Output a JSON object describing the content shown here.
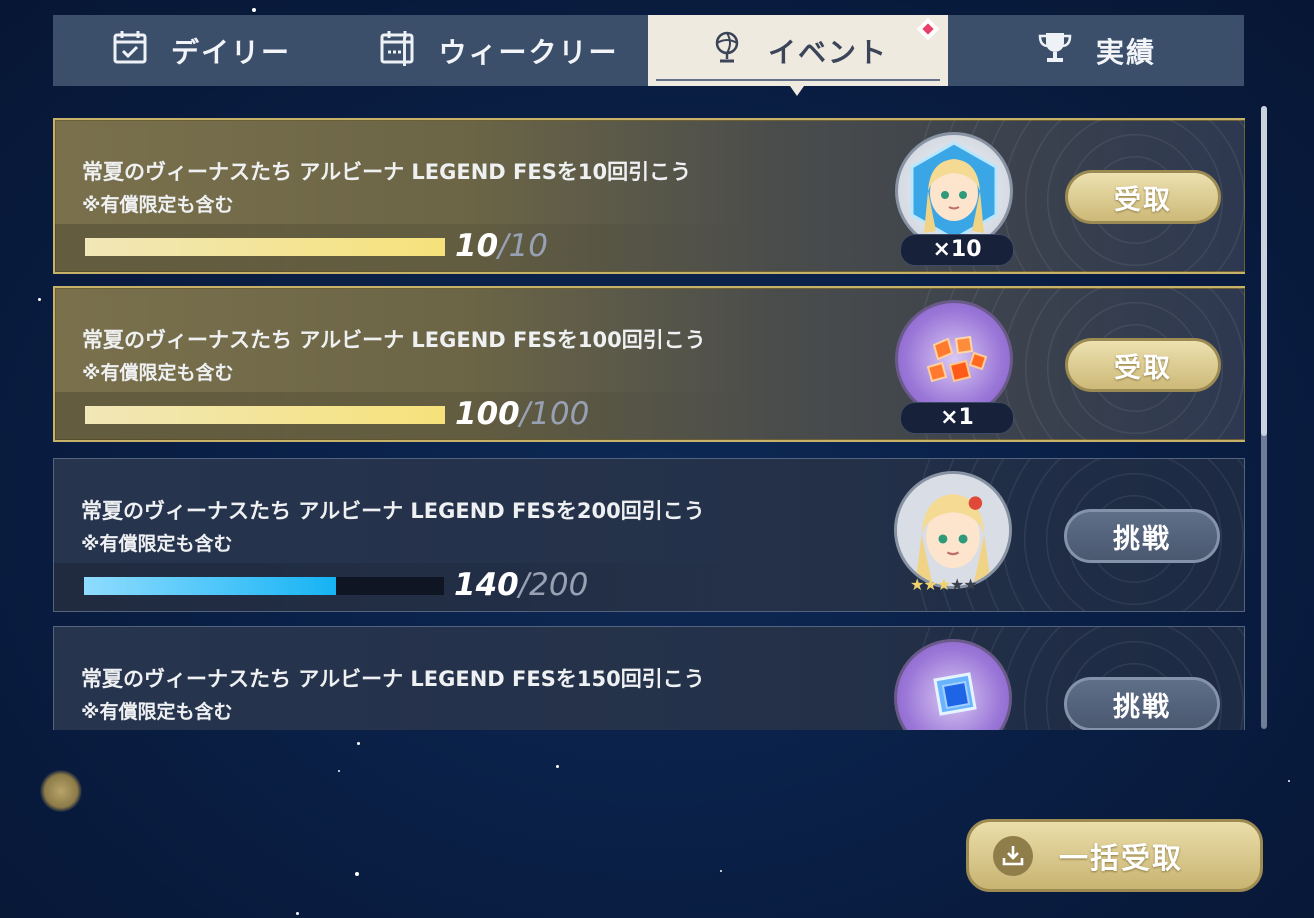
{
  "tabs": [
    {
      "label": "デイリー",
      "icon": "calendar-check-icon",
      "active": false
    },
    {
      "label": "ウィークリー",
      "icon": "calendar-week-icon",
      "active": false
    },
    {
      "label": "イベント",
      "icon": "globe-trophy-icon",
      "active": true,
      "badge": "new-diamond"
    },
    {
      "label": "実績",
      "icon": "trophy-icon",
      "active": false
    }
  ],
  "quests": [
    {
      "title": "常夏のヴィーナスたち アルビーナ LEGEND FESを10回引こう",
      "note": "※有償限定も含む",
      "current": "10",
      "total": "/10",
      "progress": 1.0,
      "reward_icon": "character-portrait-icon",
      "reward_qty": "×10",
      "button": "受取",
      "state": "claimable"
    },
    {
      "title": "常夏のヴィーナスたち アルビーナ LEGEND FESを100回引こう",
      "note": "※有償限定も含む",
      "current": "100",
      "total": "/100",
      "progress": 1.0,
      "reward_icon": "orange-crystals-icon",
      "reward_qty": "×1",
      "button": "受取",
      "state": "claimable"
    },
    {
      "title": "常夏のヴィーナスたち アルビーナ LEGEND FESを200回引こう",
      "note": "※有償限定も含む",
      "current": "140",
      "total": "/200",
      "progress": 0.7,
      "reward_icon": "character-portrait-icon",
      "reward_stars": {
        "filled": 3,
        "total": 5
      },
      "button": "挑戦",
      "state": "in-progress"
    },
    {
      "title": "常夏のヴィーナスたち アルビーナ LEGEND FESを150回引こう",
      "note": "※有償限定も含む",
      "reward_icon": "blue-cube-icon",
      "button": "挑戦",
      "state": "in-progress"
    }
  ],
  "bulk_claim": {
    "label": "一括受取",
    "icon": "download-tray-icon"
  },
  "colors": {
    "gold": "#c8b26a",
    "steel_button": "#4a5870",
    "progress_blue": "#16b3f4",
    "active_tab": "#efeae0"
  }
}
